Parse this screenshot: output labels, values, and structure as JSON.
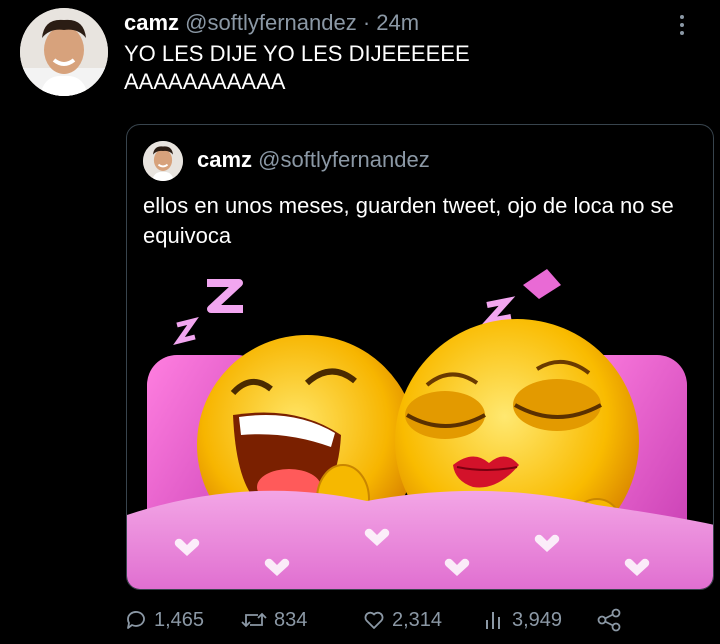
{
  "tweet": {
    "author_name": "camz",
    "handle": "@softlyfernandez",
    "separator": "·",
    "time": "24m",
    "text": "YO LES DIJE YO LES DIJEEEEEE\nAAAAAAAAAAA"
  },
  "quoted_tweet": {
    "author_name": "camz",
    "handle": "@softlyfernandez",
    "text": "ellos en unos meses, guarden tweet, ojo de loca no se equivoca"
  },
  "actions": {
    "replies": "1,465",
    "retweets": "834",
    "likes": "2,314",
    "views": "3,949"
  },
  "icons": [
    "more-icon",
    "reply-icon",
    "retweet-icon",
    "like-icon",
    "views-icon",
    "share-icon"
  ],
  "colors": {
    "background": "#000000",
    "text": "#ffffff",
    "secondary_text": "#8b98a5",
    "border": "#38444d"
  }
}
